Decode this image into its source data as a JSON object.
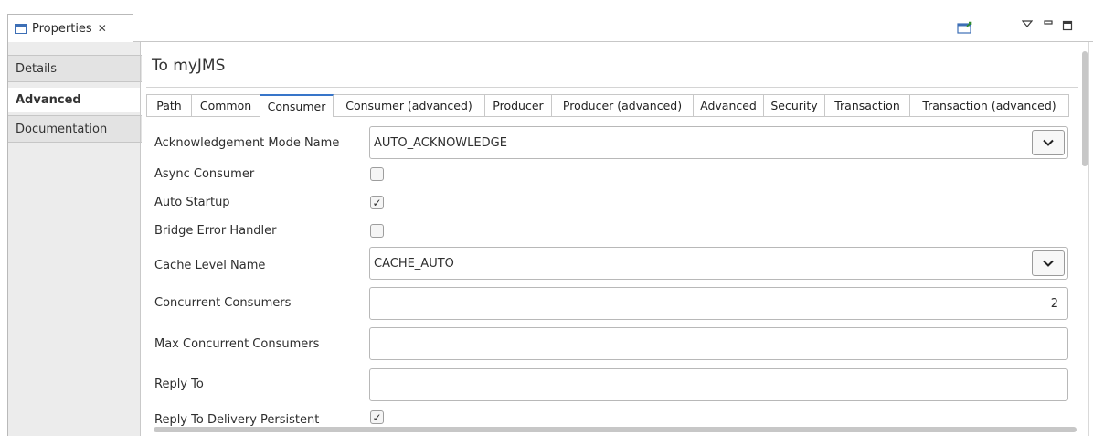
{
  "view": {
    "title": "Properties",
    "close_glyph": "✕",
    "toolbar_icons": [
      "new-window-icon",
      "view-menu-icon",
      "minimize-icon",
      "maximize-icon"
    ]
  },
  "nav": {
    "items": [
      {
        "label": "Details",
        "active": false
      },
      {
        "label": "Advanced",
        "active": true
      },
      {
        "label": "Documentation",
        "active": false
      }
    ]
  },
  "page": {
    "title": "To myJMS"
  },
  "tabs": [
    {
      "label": "Path",
      "active": false
    },
    {
      "label": "Common",
      "active": false
    },
    {
      "label": "Consumer",
      "active": true
    },
    {
      "label": "Consumer (advanced)",
      "active": false
    },
    {
      "label": "Producer",
      "active": false
    },
    {
      "label": "Producer (advanced)",
      "active": false
    },
    {
      "label": "Advanced",
      "active": false
    },
    {
      "label": "Security",
      "active": false
    },
    {
      "label": "Transaction",
      "active": false
    },
    {
      "label": "Transaction (advanced)",
      "active": false
    }
  ],
  "form": {
    "ack_mode": {
      "label": "Acknowledgement Mode Name",
      "value": "AUTO_ACKNOWLEDGE"
    },
    "async_consumer": {
      "label": "Async Consumer",
      "checked": false
    },
    "auto_startup": {
      "label": "Auto Startup",
      "checked": true
    },
    "bridge_error_handler": {
      "label": "Bridge Error Handler",
      "checked": false
    },
    "cache_level": {
      "label": "Cache Level Name",
      "value": "CACHE_AUTO"
    },
    "concurrent_consumers": {
      "label": "Concurrent Consumers",
      "value": "2"
    },
    "max_concurrent_consumers": {
      "label": "Max Concurrent Consumers",
      "value": ""
    },
    "reply_to": {
      "label": "Reply To",
      "value": ""
    },
    "reply_to_delivery_persistent": {
      "label": "Reply To Delivery Persistent",
      "checked": true
    }
  },
  "glyphs": {
    "check": "✓"
  },
  "colors": {
    "active_tab_accent": "#3875c9",
    "panel_bg": "#ececec"
  }
}
